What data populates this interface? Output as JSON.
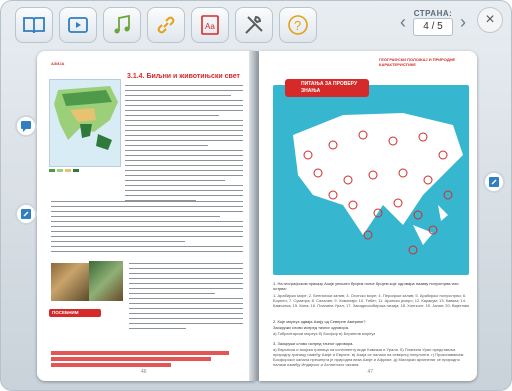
{
  "toolbar": {
    "buttons": [
      {
        "name": "book-icon"
      },
      {
        "name": "video-play-icon"
      },
      {
        "name": "music-note-icon"
      },
      {
        "name": "link-icon"
      },
      {
        "name": "glossary-aa-icon",
        "label": "Aa"
      },
      {
        "name": "tools-icon"
      },
      {
        "name": "help-question-icon",
        "label": "?"
      }
    ]
  },
  "pager": {
    "label": "СТРАНА:",
    "value": "4 / 5"
  },
  "close": {
    "label": "×"
  },
  "left_page": {
    "header": "АЗИЈА",
    "title": "3.1.4. Биљни и животињски свет",
    "remember_label": "ПОСЕБНИМ",
    "page_number": "46"
  },
  "right_page": {
    "header": "ГЕОГРАФСКИ ПОЛОЖАЈ И ПРИРОДНЕ КАРАКТЕРИСТИКЕ",
    "map_title": "ПИТАЊА ЗА ПРОВЕРУ ЗНАЊА",
    "q1": "1. На географском приказу Азије уписати бројем поље бројем које одговара називу полуострва или острва:",
    "q1_items": "1. Арабијско море; 2. Бенгалски залив; 3. Охотско море; 4. Персијски залив; 5. Арабијско полуострво; 6. Борнео; 7. Суматра; 8. Сахалин; 9. Хималаји; 10. Тибет; 11. Арапско језеро; 12. Каракум; 13. Кавказ; 14. Камчатка; 15. Кина; 16. Планина Урал; 17. Западносибирска низија; 18. Хонгконг; 19. Јапан; 20. Вијетнам",
    "q2": "2. Које морeуз одваја Азију од Северне Америке?",
    "q2_sub": "Заокружи слово испред тачног одговора.",
    "q2_opts": "а) Гибралтарски морeуз   б) Босфор   в) Берингов морeуз",
    "q3": "3. Заокружи слово испред тачног одговора.",
    "q3_items": "а) Европска и азијска граница на континенту воде Кавказа и Урала. б) Планина Урал представља природну границу између Азије и Европе. в) Азија се налази на северној полулопти. г) Прокопавањем Босфорског канала прекинута је природна веза Азије и Африке. д) Малајски архипелаг се природно налази између Индијског и Атлантског океана.",
    "page_number": "47"
  },
  "side_buttons": [
    {
      "name": "chat-note-icon"
    },
    {
      "name": "edit-note-icon"
    },
    {
      "name": "edit-note-icon-right"
    }
  ],
  "colors": {
    "accent_red": "#d62a2a",
    "map_blue": "#37b7cf",
    "toolbar_blue": "#2f7fc2"
  }
}
